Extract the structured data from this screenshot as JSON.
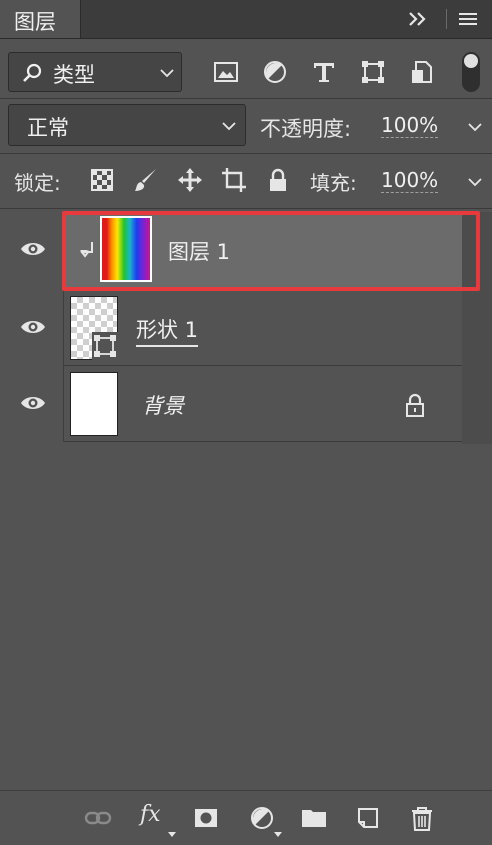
{
  "panel": {
    "title": "图层",
    "collapse_icon": "double-chevron-right-icon",
    "menu_icon": "hamburger-menu-icon"
  },
  "filter": {
    "kind_label": "类型",
    "search_icon": "search-icon",
    "filter_icons": [
      "image-icon",
      "adjustment-icon",
      "type-icon",
      "transform-icon",
      "smart-object-icon"
    ]
  },
  "blend": {
    "mode": "正常",
    "opacity_label": "不透明度:",
    "opacity_value": "100%"
  },
  "lock": {
    "label": "锁定:",
    "icons": [
      "lock-transparent-pixels-icon",
      "lock-image-pixels-icon",
      "lock-position-icon",
      "lock-artboard-icon",
      "lock-all-icon"
    ],
    "fill_label": "填充:",
    "fill_value": "100%"
  },
  "layers": [
    {
      "name": "图层 1",
      "selected": true,
      "clipped": true,
      "thumbnail": "rainbow-gradient"
    },
    {
      "name": "形状 1",
      "selected": false,
      "clipped": false,
      "thumbnail": "transparent-checker"
    },
    {
      "name": "背景",
      "selected": false,
      "clipped": false,
      "thumbnail": "white",
      "locked": true
    }
  ],
  "bottom_toolbar": [
    "link-layers-icon",
    "fx-icon",
    "add-mask-icon",
    "new-adjustment-icon",
    "new-group-icon",
    "new-layer-icon",
    "delete-icon"
  ],
  "bottom_fx_label": "fx",
  "colors": {
    "panel_bg": "#535353",
    "selected_row": "#6b6b6b",
    "highlight_border": "#e8393d"
  }
}
